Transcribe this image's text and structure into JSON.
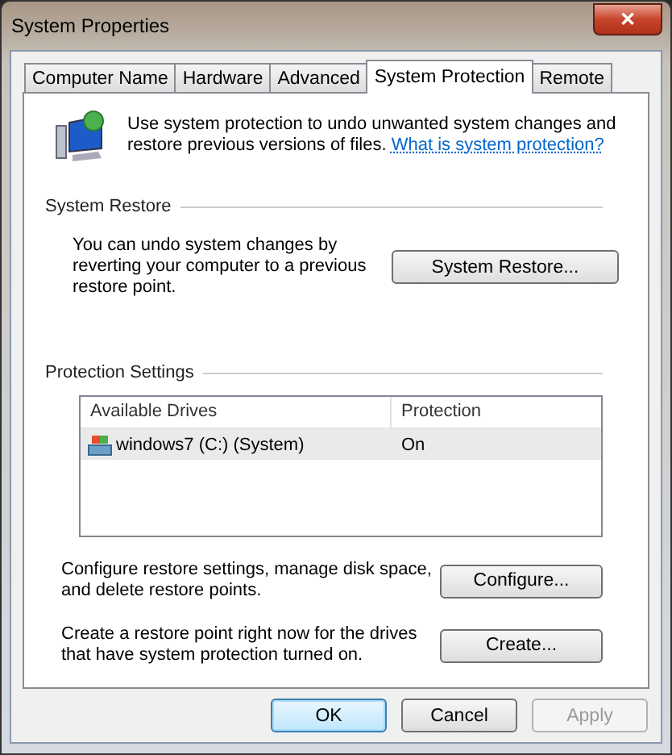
{
  "window": {
    "title": "System Properties",
    "close": "✕"
  },
  "tabs": [
    {
      "label": "Computer Name",
      "selected": false
    },
    {
      "label": "Hardware",
      "selected": false
    },
    {
      "label": "Advanced",
      "selected": false
    },
    {
      "label": "System Protection",
      "selected": true
    },
    {
      "label": "Remote",
      "selected": false
    }
  ],
  "intro": {
    "text": "Use system protection to undo unwanted system changes and restore previous versions of files.",
    "link": "What is system protection?"
  },
  "system_restore": {
    "heading": "System Restore",
    "text": "You can undo system changes by reverting your computer to a previous restore point.",
    "button": "System Restore..."
  },
  "protection_settings": {
    "heading": "Protection Settings",
    "columns": [
      "Available Drives",
      "Protection"
    ],
    "rows": [
      {
        "drive": "windows7 (C:) (System)",
        "protection": "On",
        "selected": true
      }
    ],
    "actions": [
      {
        "text": "Configure restore settings, manage disk space, and delete restore points.",
        "button": "Configure..."
      },
      {
        "text": "Create a restore point right now for the drives that have system protection turned on.",
        "button": "Create..."
      }
    ]
  },
  "buttons": [
    {
      "label": "OK",
      "default": true,
      "disabled": false
    },
    {
      "label": "Cancel",
      "default": false,
      "disabled": false
    },
    {
      "label": "Apply",
      "default": false,
      "disabled": true
    }
  ]
}
